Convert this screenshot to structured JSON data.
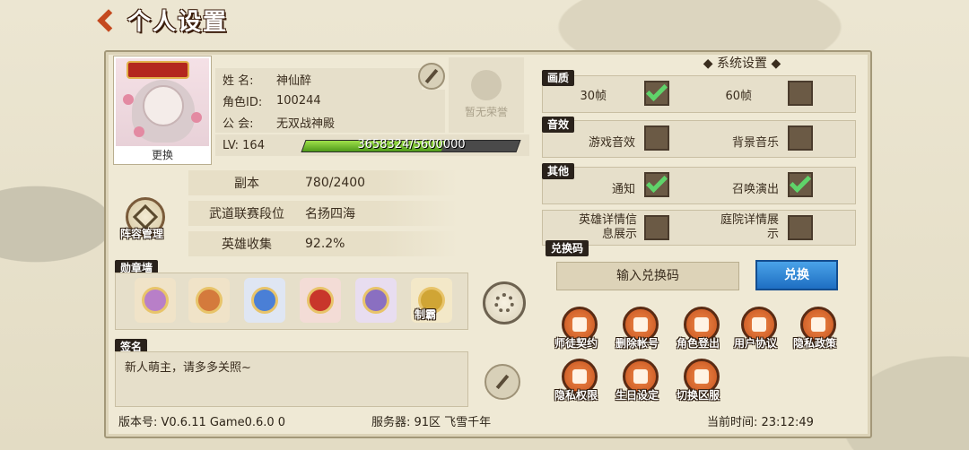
{
  "header": {
    "title": "个人设置"
  },
  "profile": {
    "change_label": "更换",
    "name_key": "姓 名:",
    "name_val": "神仙醉",
    "id_key": "角色ID:",
    "id_val": "100244",
    "guild_key": "公 会:",
    "guild_val": "无双战神殿",
    "honor_label": "暂无荣誉",
    "lv_label": "LV: 164",
    "exp_text": "3658324/5600000",
    "exp_fraction": 0.653
  },
  "stats": [
    {
      "key": "副本",
      "val": "780/2400"
    },
    {
      "key": "武道联赛段位",
      "val": "名扬四海"
    },
    {
      "key": "英雄收集",
      "val": "92.2%"
    }
  ],
  "lineup_label": "阵容管理",
  "medal_section": "勋章墙",
  "medals": [
    {
      "color": "#b87fc8"
    },
    {
      "color": "#d47a3c"
    },
    {
      "color": "#4a7fd6"
    },
    {
      "color": "#c8362b"
    },
    {
      "color": "#8a6fc1"
    },
    {
      "color": "#d0a535"
    }
  ],
  "medal_last_label": "制霸",
  "signature_section": "签名",
  "signature_text": "新人萌主，请多多关照~",
  "footer": {
    "version": "版本号: V0.6.11 Game0.6.0 0",
    "server": "服务器: 91区 飞雪千年",
    "time": "当前时间: 23:12:49"
  },
  "system": {
    "title": "系统设置",
    "graphics_label": "画质",
    "fps30": "30帧",
    "fps60": "60帧",
    "sound_label": "音效",
    "game_sound": "游戏音效",
    "bgm": "背景音乐",
    "other_label": "其他",
    "notify": "通知",
    "summon": "召唤演出",
    "hero_detail": "英雄详情信息展示",
    "yard_detail": "庭院详情展示",
    "code_label": "兑换码",
    "code_placeholder": "输入兑换码",
    "redeem": "兑换"
  },
  "actions": [
    "师徒契约",
    "删除帐号",
    "角色登出",
    "用户协议",
    "隐私政策",
    "隐私权限",
    "生日设定",
    "切换区服"
  ]
}
